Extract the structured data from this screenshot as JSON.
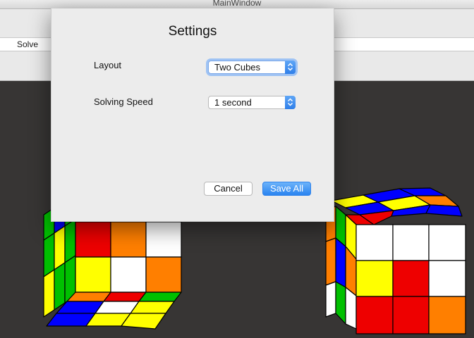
{
  "window": {
    "title": "MainWindow"
  },
  "toolbar": {
    "solve_label": "Solve"
  },
  "dialog": {
    "title": "Settings",
    "layout_label": "Layout",
    "layout_value": "Two Cubes",
    "speed_label": "Solving Speed",
    "speed_value": "1 second",
    "cancel_label": "Cancel",
    "save_label": "Save All"
  },
  "colors": {
    "accent": "#2f83ec",
    "viewport_bg": "#373534",
    "cube_red": "#ee0000",
    "cube_orange": "#ff7f00",
    "cube_yellow": "#ffff00",
    "cube_white": "#ffffff",
    "cube_green": "#00c000",
    "cube_blue": "#0000ff"
  }
}
